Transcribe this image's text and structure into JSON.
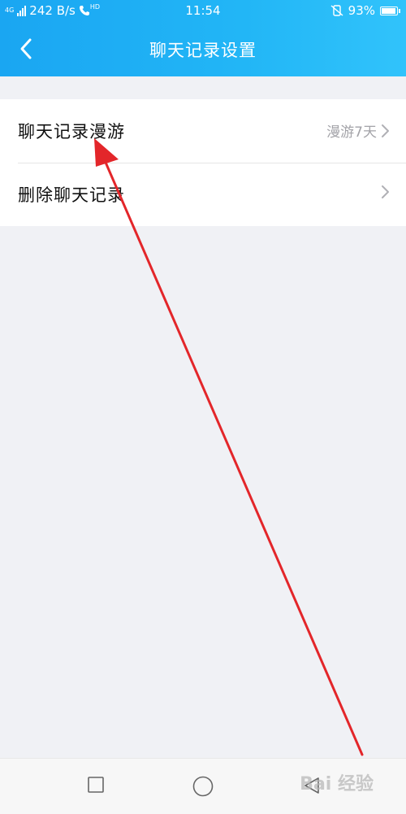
{
  "status_bar": {
    "network_label": "4G",
    "speed": "242 B/s",
    "hd_label": "HD",
    "time": "11:54",
    "battery": "93%"
  },
  "header": {
    "title": "聊天记录设置",
    "back_icon": "chevron-left-icon"
  },
  "settings": {
    "items": [
      {
        "label": "聊天记录漫游",
        "value": "漫游7天"
      },
      {
        "label": "删除聊天记录",
        "value": ""
      }
    ]
  },
  "bottom_nav": {
    "icons": [
      "square-icon",
      "circle-icon",
      "triangle-back-icon"
    ]
  },
  "watermark": "Bai 经验",
  "colors": {
    "header_start": "#1aa6f2",
    "header_end": "#31c3fb",
    "annotation_arrow": "#e3262a"
  }
}
